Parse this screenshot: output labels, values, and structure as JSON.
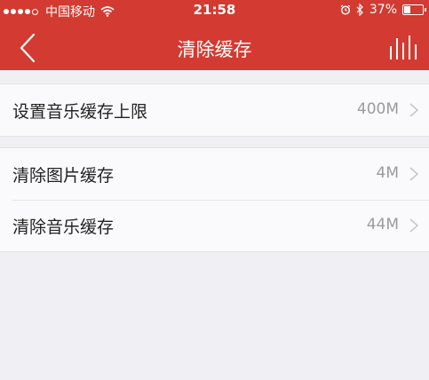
{
  "status_bar": {
    "carrier": "中国移动",
    "time": "21:58",
    "battery_percent_text": "37%",
    "battery_level": 0.37,
    "signal_bars_filled": 4,
    "signal_bars_total": 5,
    "icons": [
      "wifi-icon",
      "alarm-icon",
      "bluetooth-icon",
      "battery-icon"
    ]
  },
  "nav": {
    "title": "清除缓存",
    "back_icon": "chevron-left-icon",
    "right_icon": "equalizer-icon"
  },
  "colors": {
    "header_bg": "#d33a31",
    "page_bg": "#efeff4",
    "row_bg": "#fafafc",
    "value_text": "#9b9b9f"
  },
  "settings": {
    "group1": [
      {
        "label": "设置音乐缓存上限",
        "value": "400M"
      }
    ],
    "group2": [
      {
        "label": "清除图片缓存",
        "value": "4M"
      },
      {
        "label": "清除音乐缓存",
        "value": "44M"
      }
    ]
  }
}
